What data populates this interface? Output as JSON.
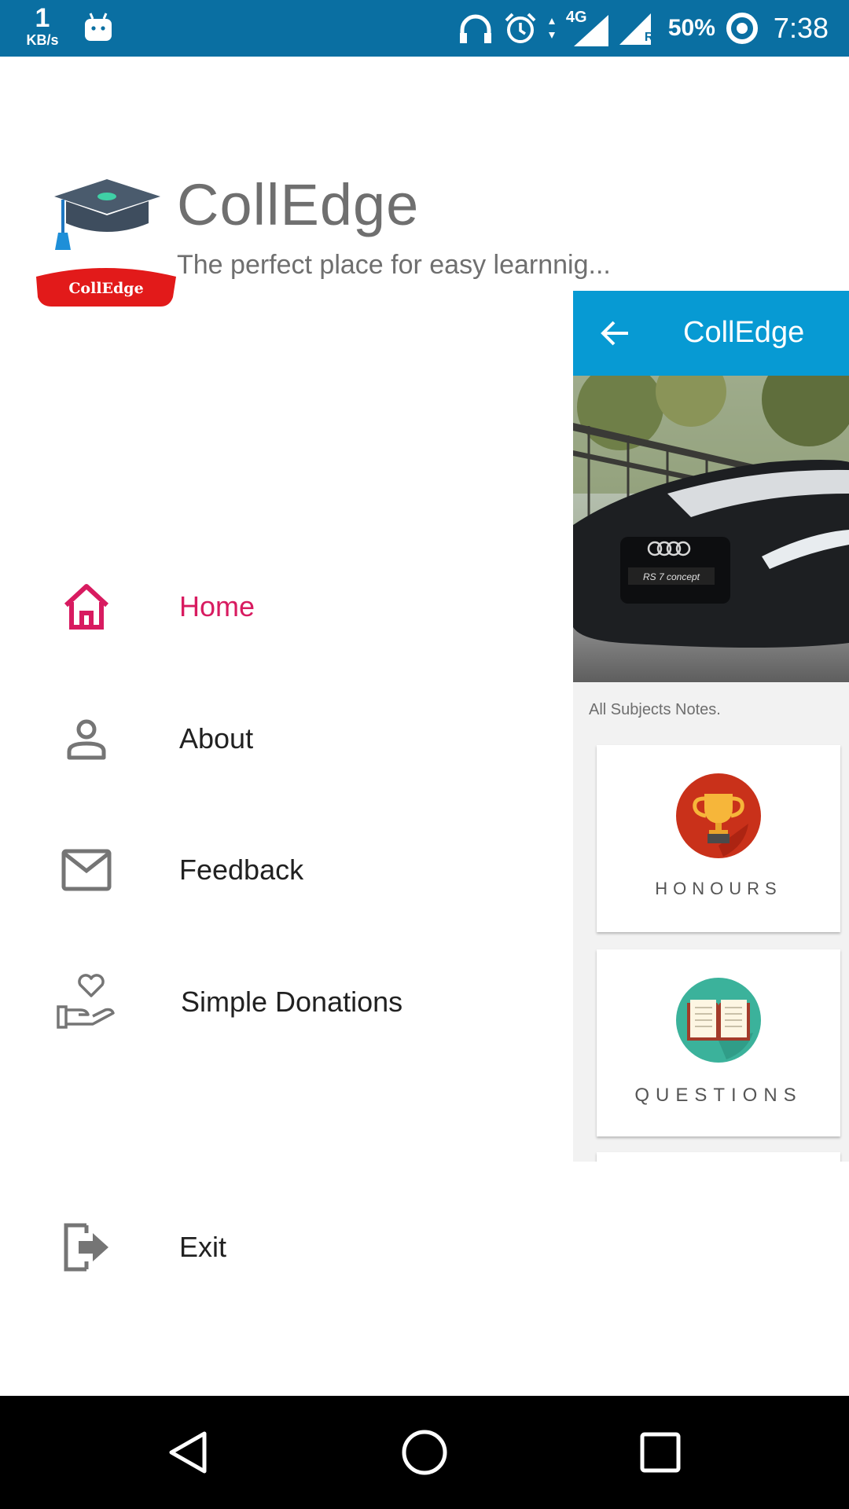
{
  "status_bar": {
    "net_speed": "1",
    "net_unit": "KB/s",
    "network_type": "4G",
    "roaming": "R",
    "battery": "50%",
    "time": "7:38",
    "color": "#0a6fa2",
    "icons": [
      "android-debug-icon",
      "headphones-icon",
      "alarm-icon",
      "data-arrows-icon",
      "signal-icon",
      "signal-roaming-icon",
      "battery-saver-icon"
    ]
  },
  "drawer": {
    "logo_text": "CollEdge",
    "app_name": "CollEdge",
    "tagline": "The perfect place for easy learnnig...",
    "items": [
      {
        "label": "Home",
        "icon": "home-icon",
        "active": true
      },
      {
        "label": "About",
        "icon": "person-icon"
      },
      {
        "label": "Feedback",
        "icon": "mail-icon"
      },
      {
        "label": "Simple Donations",
        "icon": "heart-hand-icon"
      },
      {
        "label": "Exit",
        "icon": "exit-icon"
      }
    ],
    "accent_color": "#d81b60"
  },
  "main": {
    "toolbar_title": "CollEdge",
    "toolbar_color": "#079ad3",
    "banner_text": "RS 7 concept",
    "section_title": "All Subjects Notes.",
    "cards": [
      {
        "label": "HONOURS",
        "icon": "trophy-icon"
      },
      {
        "label": "QUESTIONS",
        "icon": "book-icon"
      }
    ]
  },
  "nav_bar": {
    "buttons": [
      "back-icon",
      "home-circle-icon",
      "recents-icon"
    ]
  }
}
